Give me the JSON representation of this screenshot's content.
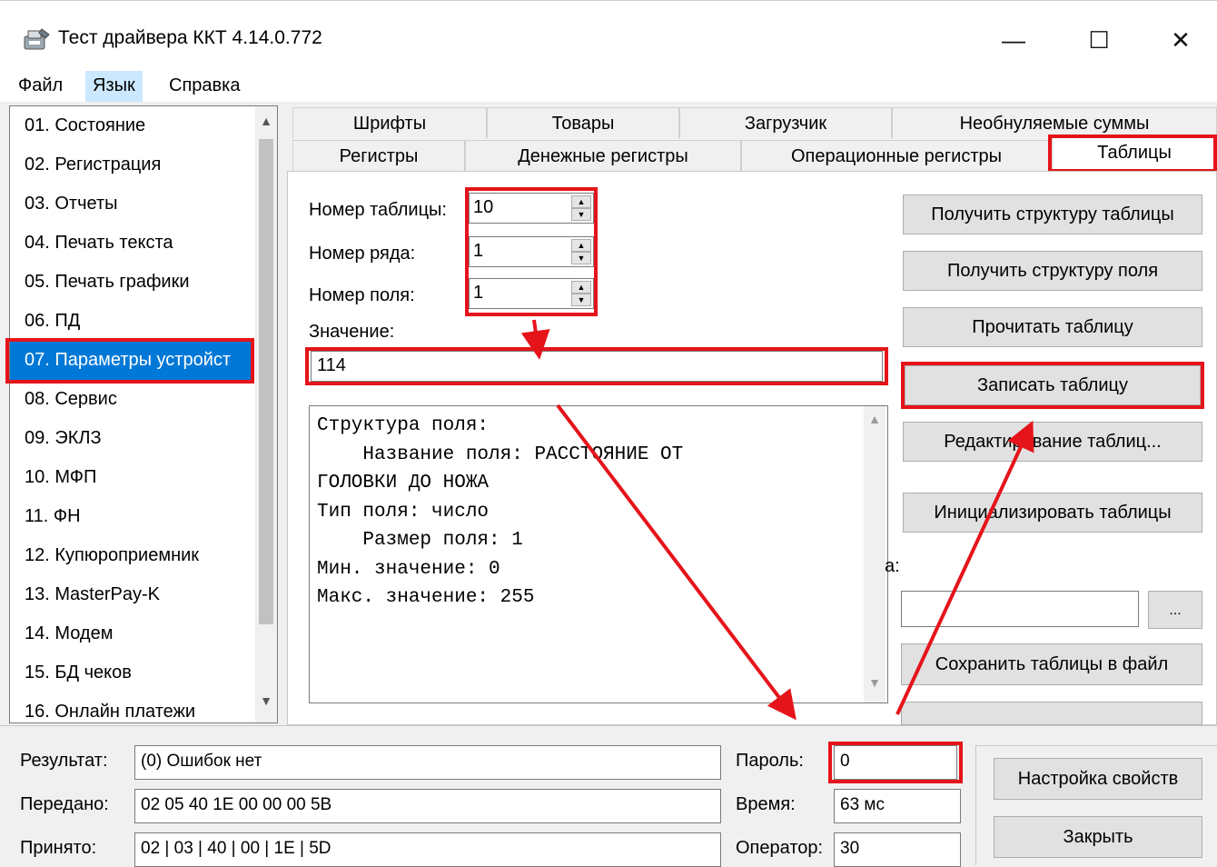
{
  "window": {
    "title": "Тест драйвера ККТ 4.14.0.772",
    "minimize": "—",
    "maximize": "☐",
    "close": "✕"
  },
  "menu": [
    "Файл",
    "Язык",
    "Справка"
  ],
  "nav": {
    "items": [
      "01. Состояние",
      "02. Регистрация",
      "03. Отчеты",
      "04. Печать текста",
      "05. Печать графики",
      "06. ПД",
      "07. Параметры устройст",
      "08. Сервис",
      "09. ЭКЛЗ",
      "10. МФП",
      "11. ФН",
      "12. Купюроприемник",
      "13. MasterPay-K",
      "14. Модем",
      "15. БД чеков",
      "16. Онлайн платежи"
    ],
    "selected_index": 6
  },
  "tabs": {
    "row1": [
      "Шрифты",
      "Товары",
      "Загрузчик",
      "Необнуляемые суммы"
    ],
    "row2": [
      "Регистры",
      "Денежные регистры",
      "Операционные регистры",
      "Таблицы"
    ],
    "active": "Таблицы"
  },
  "form": {
    "table_label": "Номер таблицы:",
    "table_value": "10",
    "row_label": "Номер ряда:",
    "row_value": "1",
    "field_label": "Номер поля:",
    "field_value": "1",
    "value_label": "Значение:",
    "value_value": "114"
  },
  "structure_text": "Структура поля:\n    Название поля: РАССТОЯНИЕ ОТ\nГОЛОВКИ ДО НОЖА\nТип поля: число\n    Размер поля: 1\nМин. значение: 0\nМакс. значение: 255",
  "buttons": {
    "get_table_structure": "Получить структуру таблицы",
    "get_field_structure": "Получить структуру поля",
    "read_table": "Прочитать таблицу",
    "write_table": "Записать таблицу",
    "edit_tables": "Редактирование таблиц...",
    "init_tables": "Инициализировать таблицы",
    "file_label_fragment": "а:",
    "browse": "...",
    "save_to_file": "Сохранить таблицы в файл"
  },
  "status": {
    "result_label": "Результат:",
    "result_value": "(0) Ошибок нет",
    "sent_label": "Передано:",
    "sent_value": "02 05 40 1E 00 00 00 5B",
    "received_label": "Принято:",
    "received_value": "02 | 03 | 40 | 00 | 1E | 5D",
    "password_label": "Пароль:",
    "password_value": "0",
    "time_label": "Время:",
    "time_value": "63 мс",
    "operator_label": "Оператор:",
    "operator_value": "30",
    "settings_button": "Настройка свойств",
    "close_button": "Закрыть"
  },
  "colors": {
    "highlight_red": "#e5141a",
    "selection_blue": "#0078d7"
  }
}
